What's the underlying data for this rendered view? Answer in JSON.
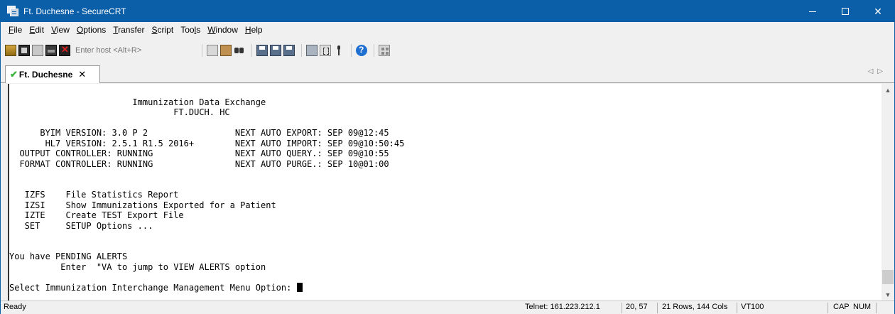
{
  "window": {
    "title": "Ft. Duchesne - SecureCRT"
  },
  "menu": {
    "items": [
      {
        "label": "File",
        "accel": "F",
        "rest": "ile"
      },
      {
        "label": "Edit",
        "accel": "E",
        "rest": "dit"
      },
      {
        "label": "View",
        "accel": "V",
        "rest": "iew"
      },
      {
        "label": "Options",
        "accel": "O",
        "rest": "ptions"
      },
      {
        "label": "Transfer",
        "accel": "T",
        "rest": "ransfer"
      },
      {
        "label": "Script",
        "accel": "S",
        "rest": "cript"
      },
      {
        "label": "Tools",
        "pre": "Too",
        "accel": "l",
        "rest": "s"
      },
      {
        "label": "Window",
        "accel": "W",
        "rest": "indow"
      },
      {
        "label": "Help",
        "accel": "H",
        "rest": "elp"
      }
    ]
  },
  "toolbar": {
    "host_placeholder": "Enter host <Alt+R>"
  },
  "tabs": [
    {
      "label": "Ft. Duchesne",
      "status_icon": "connected-check-icon"
    }
  ],
  "terminal": {
    "lines": [
      "",
      "                        Immunization Data Exchange",
      "                                FT.DUCH. HC",
      "",
      "      BYIM VERSION: 3.0 P 2                 NEXT AUTO EXPORT: SEP 09@12:45",
      "       HL7 VERSION: 2.5.1 R1.5 2016+        NEXT AUTO IMPORT: SEP 09@10:50:45",
      "  OUTPUT CONTROLLER: RUNNING                NEXT AUTO QUERY.: SEP 09@10:55",
      "  FORMAT CONTROLLER: RUNNING                NEXT AUTO PURGE.: SEP 10@01:00",
      "",
      "",
      "   IZFS    File Statistics Report",
      "   IZSI    Show Immunizations Exported for a Patient",
      "   IZTE    Create TEST Export File",
      "   SET     SETUP Options ...",
      "",
      "",
      "You have PENDING ALERTS",
      "          Enter  \"VA to jump to VIEW ALERTS option",
      "",
      "Select Immunization Interchange Management Menu Option: "
    ]
  },
  "status": {
    "ready": "Ready",
    "connection": "Telnet: 161.223.212.1",
    "cursor_pos": "20, 57",
    "size": "21 Rows, 144 Cols",
    "emulation": "VT100",
    "caps": "CAP",
    "num": "NUM"
  }
}
